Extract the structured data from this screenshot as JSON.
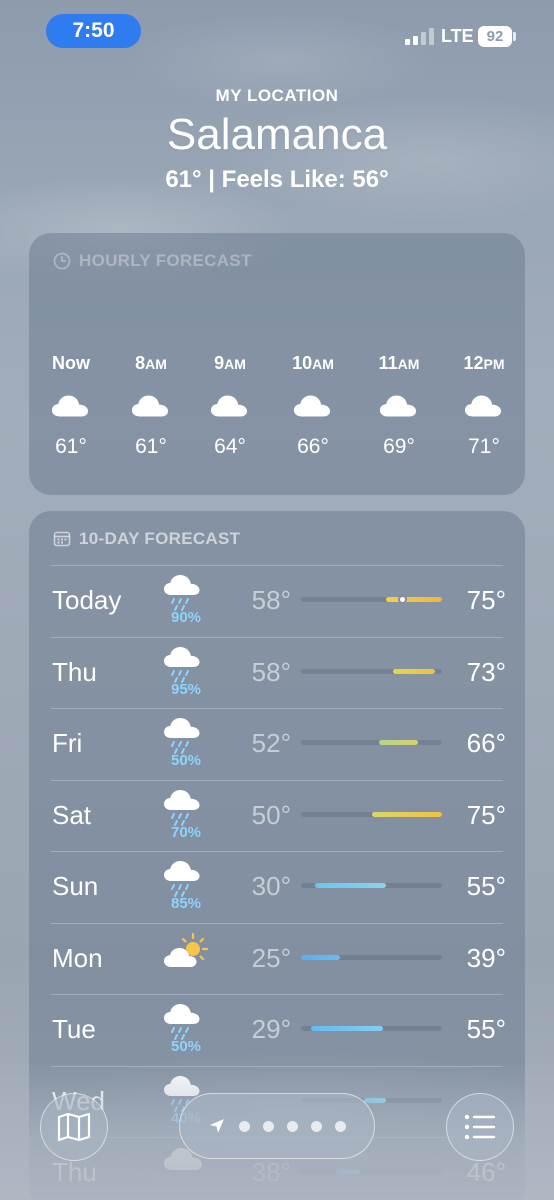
{
  "status": {
    "time": "7:50",
    "network": "LTE",
    "battery": "92"
  },
  "header": {
    "location_label": "MY LOCATION",
    "city": "Salamanca",
    "summary": "61° | Feels Like: 56°"
  },
  "hourly": {
    "title": "HOURLY FORECAST",
    "hours": [
      {
        "label": "Now",
        "icon": "cloud-icon",
        "temp": "61°"
      },
      {
        "label": "8AM",
        "icon": "cloud-icon",
        "temp": "61°"
      },
      {
        "label": "9AM",
        "icon": "cloud-icon",
        "temp": "64°"
      },
      {
        "label": "10AM",
        "icon": "cloud-icon",
        "temp": "66°"
      },
      {
        "label": "11AM",
        "icon": "cloud-icon",
        "temp": "69°"
      },
      {
        "label": "12PM",
        "icon": "cloud-icon",
        "temp": "71°"
      }
    ]
  },
  "daily": {
    "title": "10-DAY FORECAST",
    "days": [
      {
        "day": "Today",
        "icon": "cloud-rain-icon",
        "precip": "90%",
        "low": "58°",
        "high": "75°",
        "bar_start": 0.6,
        "bar_end": 1.0,
        "color_a": "#f0d24a",
        "color_b": "#f0b43c",
        "current": 0.72
      },
      {
        "day": "Thu",
        "icon": "cloud-rain-icon",
        "precip": "95%",
        "low": "58°",
        "high": "73°",
        "bar_start": 0.65,
        "bar_end": 0.95,
        "color_a": "#ecd24c",
        "color_b": "#efc040"
      },
      {
        "day": "Fri",
        "icon": "cloud-rain-icon",
        "precip": "50%",
        "low": "52°",
        "high": "66°",
        "bar_start": 0.55,
        "bar_end": 0.83,
        "color_a": "#b7d48c",
        "color_b": "#d4d070"
      },
      {
        "day": "Sat",
        "icon": "cloud-rain-icon",
        "precip": "70%",
        "low": "50°",
        "high": "75°",
        "bar_start": 0.5,
        "bar_end": 1.0,
        "color_a": "#d7d66e",
        "color_b": "#f0c23f"
      },
      {
        "day": "Sun",
        "icon": "cloud-rain-icon",
        "precip": "85%",
        "low": "30°",
        "high": "55°",
        "bar_start": 0.1,
        "bar_end": 0.6,
        "color_a": "#6ec4ef",
        "color_b": "#86d3ea"
      },
      {
        "day": "Mon",
        "icon": "partly-sunny-icon",
        "precip": "",
        "low": "25°",
        "high": "39°",
        "bar_start": 0.0,
        "bar_end": 0.28,
        "color_a": "#5aaef0",
        "color_b": "#6cbbf0"
      },
      {
        "day": "Tue",
        "icon": "cloud-rain-icon",
        "precip": "50%",
        "low": "29°",
        "high": "55°",
        "bar_start": 0.07,
        "bar_end": 0.58,
        "color_a": "#64bbf0",
        "color_b": "#82cfef"
      },
      {
        "day": "Wed",
        "icon": "cloud-rain-icon",
        "precip": "40%",
        "low": "",
        "high": "",
        "bar_start": 0.45,
        "bar_end": 0.6,
        "color_a": "#7ccaf0",
        "color_b": "#90d5ee"
      },
      {
        "day": "Thu",
        "icon": "cloud-icon",
        "precip": "",
        "low": "38°",
        "high": "46°",
        "bar_start": 0.25,
        "bar_end": 0.42,
        "color_a": "#6cbcef",
        "color_b": "#7ac6ef"
      }
    ]
  },
  "toolbar": {
    "map_icon": "map-icon",
    "location_icon": "location-arrow-icon",
    "list_icon": "list-icon",
    "page_dots": 5
  }
}
